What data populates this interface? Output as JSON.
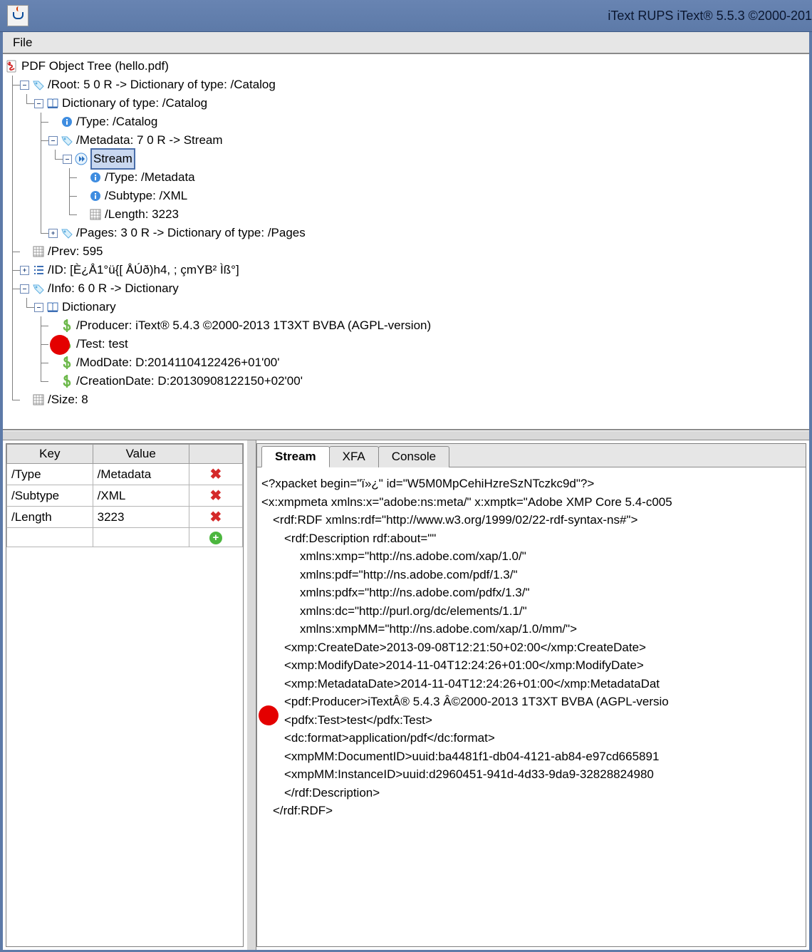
{
  "app": {
    "title": "iText RUPS iText® 5.5.3 ©2000-201"
  },
  "menu": {
    "file": "File"
  },
  "tree": {
    "root_label": "PDF Object Tree (hello.pdf)",
    "n_root": "/Root: 5 0 R -> Dictionary of type: /Catalog",
    "n_catalog": "Dictionary of type: /Catalog",
    "n_cat_type": "/Type: /Catalog",
    "n_metadata": "/Metadata: 7 0 R -> Stream",
    "n_stream": "Stream",
    "n_stream_type": "/Type: /Metadata",
    "n_stream_subtype": "/Subtype: /XML",
    "n_stream_length": "/Length: 3223",
    "n_pages": "/Pages: 3 0 R -> Dictionary of type: /Pages",
    "n_prev": "/Prev: 595",
    "n_id": "/ID: [È¿Å1°ü{[  ÅÚð)h4,    ;  çmYB²     Ìß°]",
    "n_info": "/Info: 6 0 R -> Dictionary",
    "n_dict": "Dictionary",
    "n_producer": "/Producer: iText® 5.4.3 ©2000-2013 1T3XT BVBA (AGPL-version)",
    "n_test": "/Test: test",
    "n_moddate": "/ModDate: D:20141104122426+01'00'",
    "n_creationdate": "/CreationDate: D:20130908122150+02'00'",
    "n_size": "/Size: 8"
  },
  "table": {
    "col_key": "Key",
    "col_value": "Value",
    "rows": [
      {
        "key": "/Type",
        "value": "/Metadata"
      },
      {
        "key": "/Subtype",
        "value": "/XML"
      },
      {
        "key": "/Length",
        "value": "3223"
      }
    ]
  },
  "tabs": {
    "stream": "Stream",
    "xfa": "XFA",
    "console": "Console"
  },
  "stream_lines": {
    "l0": "<?xpacket begin=\"ï»¿\" id=\"W5M0MpCehiHzreSzNTczkc9d\"?>",
    "l1": "<x:xmpmeta xmlns:x=\"adobe:ns:meta/\" x:xmptk=\"Adobe XMP Core 5.4-c005",
    "l2": "<rdf:RDF xmlns:rdf=\"http://www.w3.org/1999/02/22-rdf-syntax-ns#\">",
    "l3": "<rdf:Description rdf:about=\"\"",
    "l4": "xmlns:xmp=\"http://ns.adobe.com/xap/1.0/\"",
    "l5": "xmlns:pdf=\"http://ns.adobe.com/pdf/1.3/\"",
    "l6": "xmlns:pdfx=\"http://ns.adobe.com/pdfx/1.3/\"",
    "l7": "xmlns:dc=\"http://purl.org/dc/elements/1.1/\"",
    "l8": "xmlns:xmpMM=\"http://ns.adobe.com/xap/1.0/mm/\">",
    "l9": "<xmp:CreateDate>2013-09-08T12:21:50+02:00</xmp:CreateDate>",
    "l10": "<xmp:ModifyDate>2014-11-04T12:24:26+01:00</xmp:ModifyDate>",
    "l11": "<xmp:MetadataDate>2014-11-04T12:24:26+01:00</xmp:MetadataDat",
    "l12": "<pdf:Producer>iTextÂ® 5.4.3 Â©2000-2013 1T3XT BVBA (AGPL-versio",
    "l13": "<pdfx:Test>test</pdfx:Test>",
    "l14": "<dc:format>application/pdf</dc:format>",
    "l15": "<xmpMM:DocumentID>uuid:ba4481f1-db04-4121-ab84-e97cd665891",
    "l16": "<xmpMM:InstanceID>uuid:d2960451-941d-4d33-9da9-32828824980",
    "l17": "</rdf:Description>",
    "l18": "</rdf:RDF>"
  }
}
